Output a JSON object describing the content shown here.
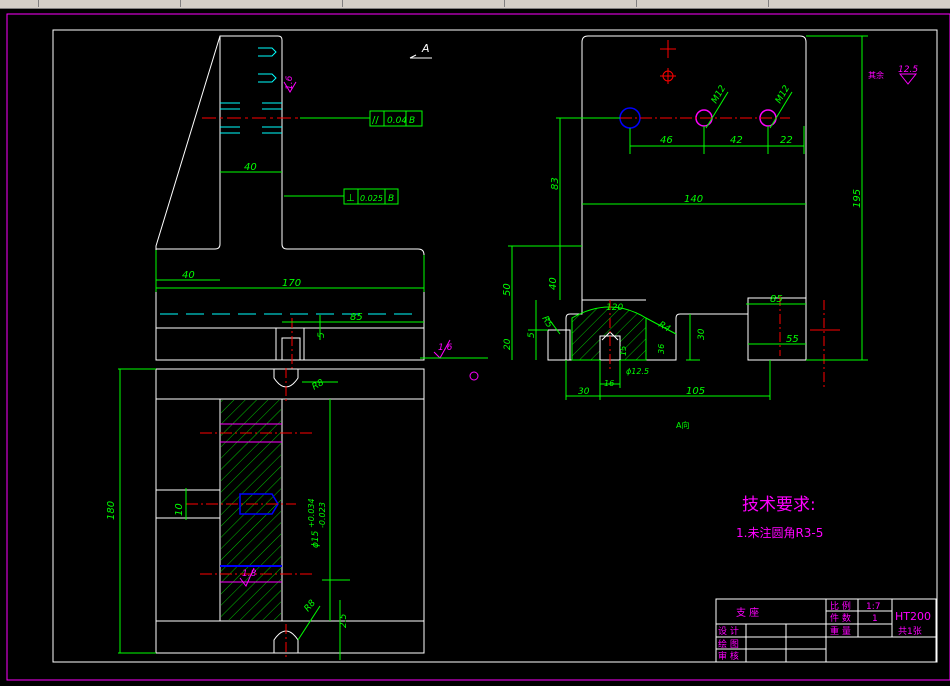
{
  "section_label": "A",
  "view_label": "A向",
  "tolerances": {
    "parallel_symbol": "//",
    "parallel": "0.04",
    "parallel_datum": "B",
    "perp_symbol": "⊥",
    "perp": "0.025",
    "perp_datum": "B"
  },
  "roughness": {
    "r1": "1.6",
    "r2": "1.6",
    "r3": "1.8",
    "r4": "12.5",
    "r4_prefix": "其余"
  },
  "front_dims": {
    "d40_top": "40",
    "d40_bottom": "40",
    "d170": "170",
    "d85": "85",
    "d5": "5",
    "d180": "180",
    "d10": "10",
    "phi15": "ϕ15",
    "tol_upper": "+0.034",
    "tol_lower": "-0.023",
    "r8_a": "R8",
    "r8_b": "R8",
    "d25": "2.5"
  },
  "side_dims": {
    "m12_a": "M12",
    "m12_b": "M12",
    "d46": "46",
    "d42": "42",
    "d22": "22",
    "d140": "140",
    "d195": "195",
    "d83": "83",
    "d50": "50",
    "d40": "40",
    "d30_left": "30",
    "d5": "5",
    "d20": "20",
    "r5": "R5",
    "r4": "R4",
    "d120": "120",
    "d15": "15",
    "d16": "16",
    "d36": "36",
    "phi12": "ϕ12.5",
    "d30_bottom": "30",
    "d105": "105",
    "d85": "85",
    "d55": "55",
    "d30_right": "30"
  },
  "tech": {
    "title": "技术要求:",
    "item1": "1.未注圆角R3-5"
  },
  "title_block": {
    "part_name": "支  座",
    "scale_label": "比 例",
    "scale_value": "1:7",
    "qty_label": "件 数",
    "qty_value": "1",
    "weight_label": "重 量",
    "material": "HT200",
    "sheets": "共1张",
    "design": "设 计",
    "drawing": "绘 图",
    "review": "审 核"
  }
}
